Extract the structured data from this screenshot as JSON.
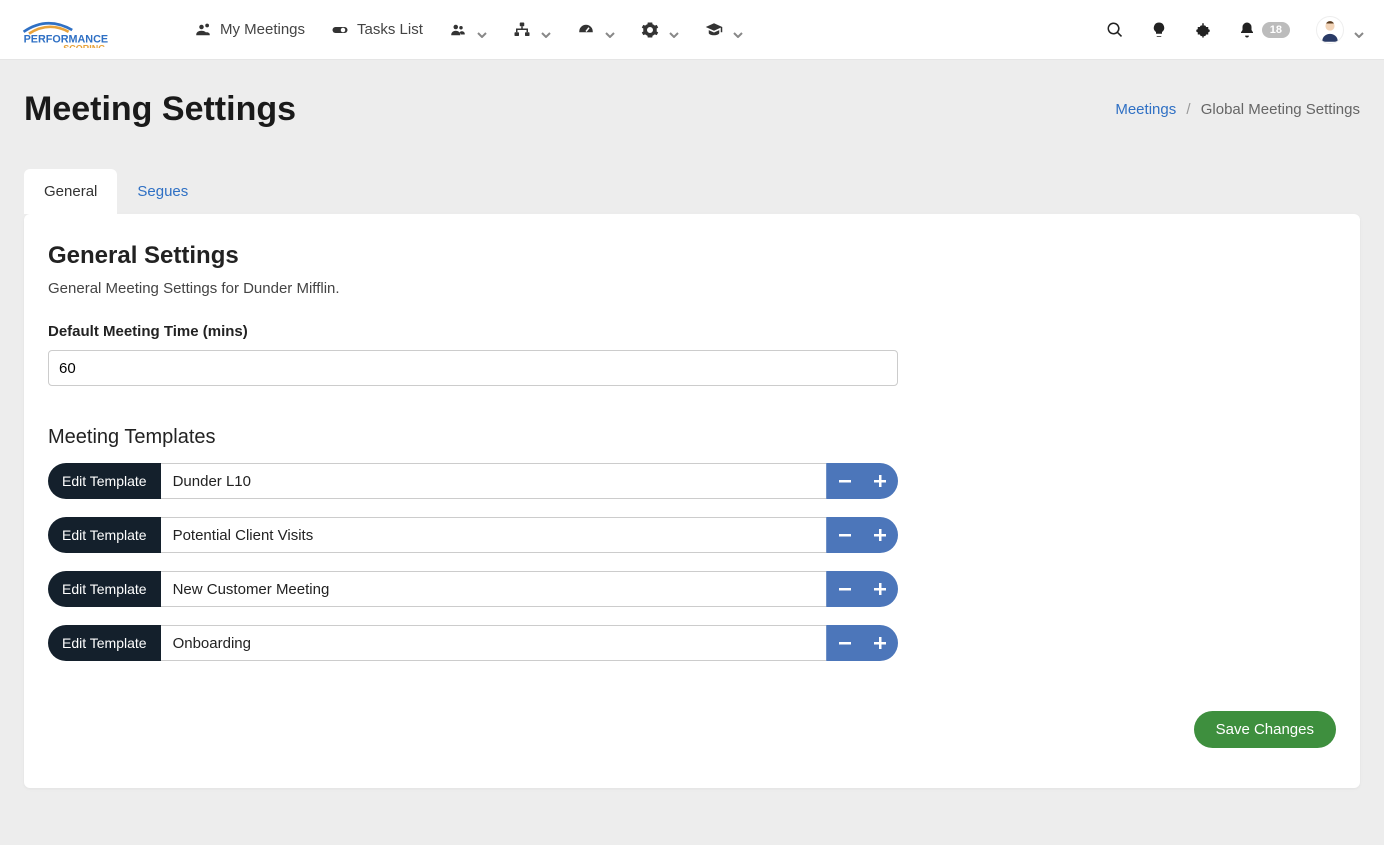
{
  "topnav": {
    "my_meetings": "My Meetings",
    "tasks_list": "Tasks List"
  },
  "right": {
    "notif_count": "18"
  },
  "page": {
    "title": "Meeting Settings",
    "breadcrumb_root": "Meetings",
    "breadcrumb_current": "Global Meeting Settings"
  },
  "tabs": {
    "general": "General",
    "segues": "Segues"
  },
  "general": {
    "heading": "General Settings",
    "subheading": "General Meeting Settings for Dunder Mifflin.",
    "default_time_label": "Default Meeting Time (mins)",
    "default_time_value": "60",
    "templates_heading": "Meeting Templates",
    "edit_label": "Edit Template",
    "templates": [
      {
        "name": "Dunder L10"
      },
      {
        "name": "Potential Client Visits"
      },
      {
        "name": "New Customer Meeting"
      },
      {
        "name": "Onboarding"
      }
    ],
    "save_label": "Save Changes"
  }
}
